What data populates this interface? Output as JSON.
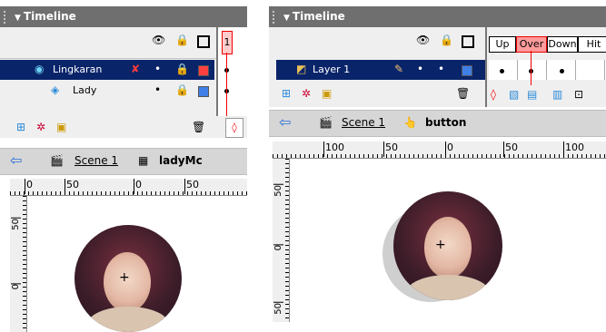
{
  "colors": {
    "titlebar": "#6f6f6f",
    "selected_layer": "#0a246a",
    "playhead": "#e00000",
    "layer_red": "#ff4040",
    "layer_blue": "#3f7fe6"
  },
  "left": {
    "title": "Timeline",
    "icons": [
      "eye-icon",
      "lock-icon",
      "outline-icon"
    ],
    "layers": [
      {
        "name": "Lingkaran",
        "selected": true,
        "icon": "mask-layer-icon",
        "color": "red"
      },
      {
        "name": "Lady",
        "selected": false,
        "icon": "masked-layer-icon",
        "color": "blue"
      }
    ],
    "frame_number": "1",
    "breadcrumb": {
      "scene": "Scene 1",
      "symbol": "ladyMc"
    },
    "ruler_h": [
      "0",
      "50",
      "0",
      "50"
    ],
    "ruler_v": [
      "50",
      "0"
    ]
  },
  "right": {
    "title": "Timeline",
    "frame_labels": [
      "Up",
      "Over",
      "Down",
      "Hit"
    ],
    "layers": [
      {
        "name": "Layer 1",
        "selected": true,
        "icon": "layer-icon",
        "color": "blue"
      }
    ],
    "breadcrumb": {
      "scene": "Scene 1",
      "symbol": "button"
    },
    "ruler_h": [
      "100",
      "50",
      "0",
      "50",
      "100"
    ],
    "ruler_v": [
      "50",
      "0",
      "50"
    ]
  }
}
